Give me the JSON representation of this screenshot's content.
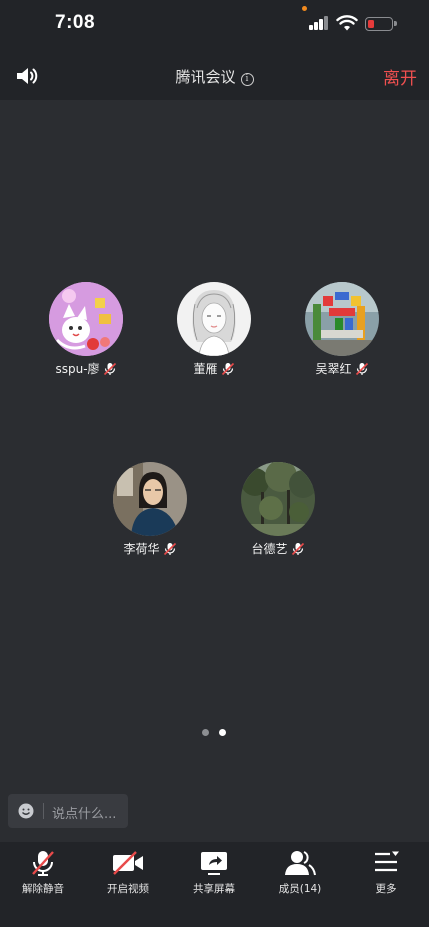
{
  "status_bar": {
    "time": "7:08"
  },
  "header": {
    "title": "腾讯会议",
    "info_icon": "info-icon",
    "leave_label": "离开",
    "leave_color": "#f05050"
  },
  "participants": [
    {
      "name": "sspu-廖",
      "muted": true
    },
    {
      "name": "董雁",
      "muted": true
    },
    {
      "name": "吴翠红",
      "muted": true
    },
    {
      "name": "李荷华",
      "muted": true
    },
    {
      "name": "台德艺",
      "muted": true
    }
  ],
  "pager": {
    "total": 2,
    "current": 2
  },
  "chat": {
    "placeholder": "说点什么..."
  },
  "toolbar": {
    "unmute": "解除静音",
    "video": "开启视频",
    "share": "共享屏幕",
    "members": "成员(14)",
    "more": "更多"
  },
  "colors": {
    "background": "#2b2d31",
    "bar": "#222428",
    "mute_red": "#e84a4a"
  }
}
